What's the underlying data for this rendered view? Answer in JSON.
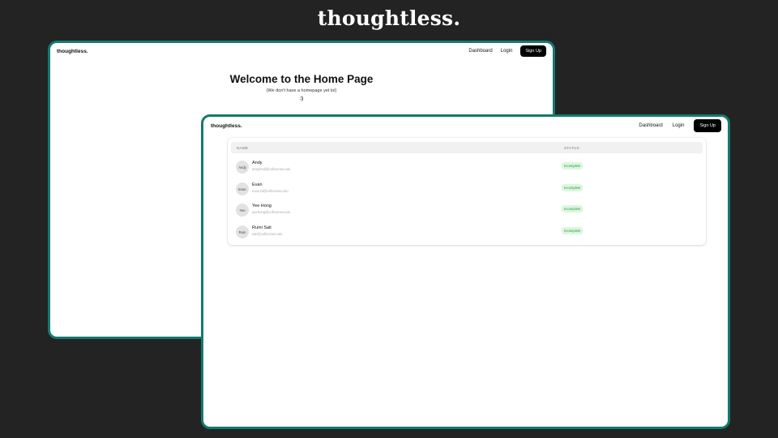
{
  "hero": {
    "title": "thoughtless."
  },
  "back_window": {
    "nav": {
      "brand": "thoughtless.",
      "dashboard": "Dashboard",
      "login": "Login",
      "signup": "Sign Up"
    },
    "home": {
      "title": "Welcome to the Home Page",
      "subtitle": "(We don't have a homepage yet lol)",
      "smiley": ":)"
    }
  },
  "front_window": {
    "nav": {
      "brand": "thoughtless.",
      "dashboard": "Dashboard",
      "login": "Login",
      "signup": "Sign Up"
    },
    "table": {
      "headers": {
        "name": "NAME",
        "status": "STATUS"
      },
      "rows": [
        {
          "initials": "Andy",
          "name": "Andy",
          "email": "andyfred@collcomes.edu",
          "status": "Incomplete"
        },
        {
          "initials": "Evan",
          "name": "Evan",
          "email": "evan.bi@collcomes.edu",
          "status": "Incomplete"
        },
        {
          "initials": "Yee",
          "name": "Yee Hong",
          "email": "yeehong@collcomes.edu",
          "status": "Incomplete"
        },
        {
          "initials": "Rum",
          "name": "Rumi Sait",
          "email": "sait@collcomes.edu",
          "status": "Incomplete"
        }
      ]
    }
  },
  "colors": {
    "background": "#232323",
    "window_border": "#137a6f",
    "badge_bg": "#dcf7df",
    "badge_text": "#2f9a46"
  }
}
